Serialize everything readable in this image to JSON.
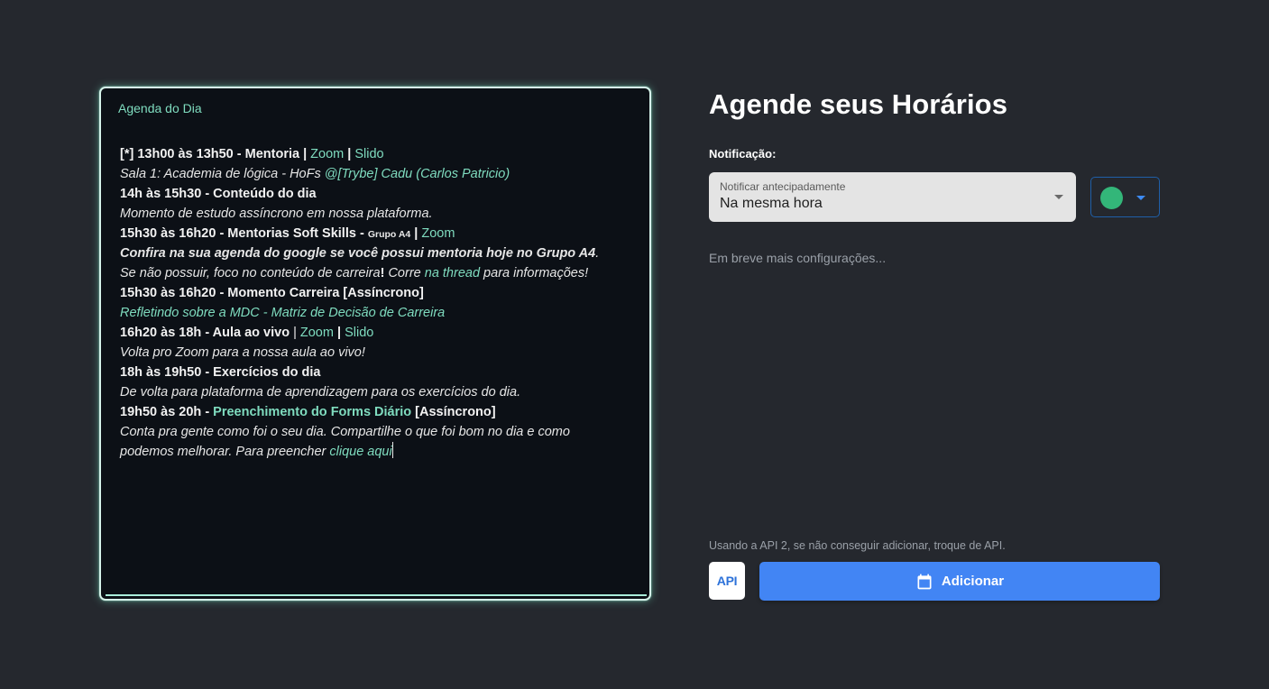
{
  "colors": {
    "accent": "#7fdcbf",
    "primary_button": "#4285f4",
    "event_color": "#33b679"
  },
  "agenda": {
    "label": "Agenda do Dia",
    "lines": [
      {
        "parts": [
          {
            "text": "[*] 13h00 às 13h50 - Mentoria  | ",
            "style": "b"
          },
          {
            "text": "Zoom",
            "style": "link"
          },
          {
            "text": " | ",
            "style": "b"
          },
          {
            "text": "Slido",
            "style": "link"
          }
        ]
      },
      {
        "parts": [
          {
            "text": "Sala 1:  Academia de lógica - HoFs  ",
            "style": "i"
          },
          {
            "text": "@[Trybe] Cadu (Carlos Patricio)",
            "style": "i link"
          }
        ]
      },
      {
        "parts": [
          {
            "text": "14h às 15h30 - Conteúdo do dia",
            "style": "b"
          }
        ]
      },
      {
        "parts": [
          {
            "text": "Momento de estudo assíncrono em nossa plataforma.",
            "style": "i"
          }
        ]
      },
      {
        "parts": [
          {
            "text": "15h30 às 16h20 - Mentorias Soft Skills - ",
            "style": "b"
          },
          {
            "text": "Grupo A4",
            "style": "small"
          },
          {
            "text": "  | ",
            "style": "b"
          },
          {
            "text": "Zoom",
            "style": "link"
          }
        ]
      },
      {
        "parts": [
          {
            "text": "Confira na sua agenda do google se você possui mentoria hoje no Grupo A4",
            "style": "b i"
          },
          {
            "text": ".",
            "style": "i"
          }
        ]
      },
      {
        "parts": [
          {
            "text": "Se não possuir, foco no conteúdo  de carreira",
            "style": "i"
          },
          {
            "text": "!",
            "style": "b"
          },
          {
            "text": " Corre ",
            "style": "i"
          },
          {
            "text": "na thread",
            "style": "i link"
          },
          {
            "text": " para informações!",
            "style": "i"
          }
        ]
      },
      {
        "parts": [
          {
            "text": "15h30 às 16h20 - Momento  Carreira  [Assíncrono]",
            "style": "b"
          }
        ]
      },
      {
        "parts": [
          {
            "text": " Refletindo sobre a MDC - Matriz de Decisão de Carreira",
            "style": "i link"
          }
        ]
      },
      {
        "parts": [
          {
            "text": "16h20 às 18h - Aula ao vivo",
            "style": "b"
          },
          {
            "text": " | ",
            "style": ""
          },
          {
            "text": "Zoom",
            "style": "link"
          },
          {
            "text": " | ",
            "style": "b"
          },
          {
            "text": "Slido",
            "style": "link"
          }
        ]
      },
      {
        "parts": [
          {
            "text": "Volta pro Zoom para a nossa aula ao vivo!",
            "style": "i"
          }
        ]
      },
      {
        "parts": [
          {
            "text": "18h às 19h50 - Exercícios do dia",
            "style": "b"
          }
        ]
      },
      {
        "parts": [
          {
            "text": "De volta para plataforma de aprendizagem para os exercícios do dia.",
            "style": "i"
          }
        ]
      },
      {
        "parts": [
          {
            "text": "19h50 às 20h - ",
            "style": "b"
          },
          {
            "text": "Preenchimento do Forms Diário",
            "style": "b link"
          },
          {
            "text": " [Assíncrono]",
            "style": "b"
          }
        ]
      },
      {
        "parts": [
          {
            "text": "Conta pra gente como foi o seu dia. Compartilhe o que foi bom no dia e como",
            "style": "i"
          }
        ]
      },
      {
        "parts": [
          {
            "text": "podemos melhorar. Para preencher ",
            "style": "i"
          },
          {
            "text": "clique aqui",
            "style": "i link"
          }
        ],
        "caret": true
      }
    ]
  },
  "scheduler": {
    "title": "Agende seus Horários",
    "notification_label": "Notificação:",
    "select": {
      "floating_label": "Notificar antecipadamente",
      "value": "Na mesma hora"
    },
    "color_picker_icon": "chevron-down-icon",
    "soon_text": "Em breve mais configurações...",
    "api_note": "Usando a API 2, se não conseguir adicionar, troque de API.",
    "api_button_label": "API",
    "add_button_label": "Adicionar",
    "add_button_icon": "calendar-icon"
  }
}
